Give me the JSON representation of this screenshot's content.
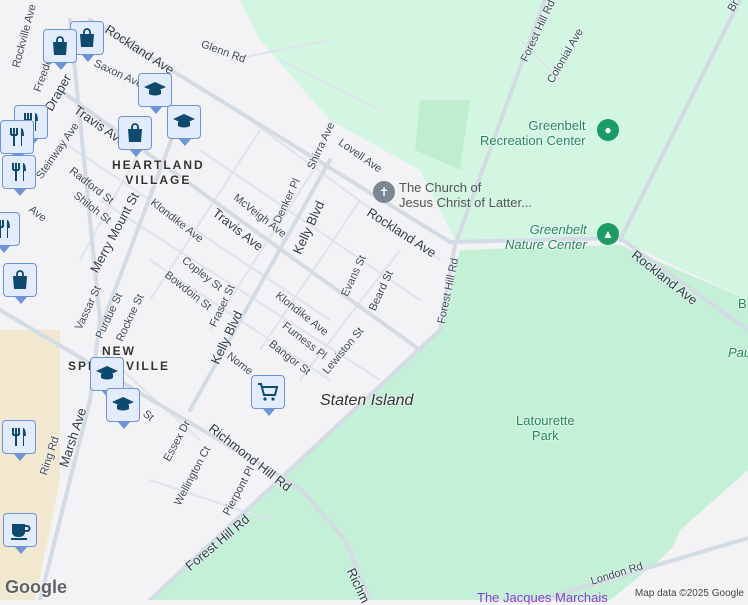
{
  "streets": {
    "rockland_top": "Rockland Ave",
    "rockland_mid": "Rockland Ave",
    "rockland_east": "Rockland Ave",
    "glenn": "Glenn Rd",
    "saxon": "Saxon Ave",
    "rockville": "Rockville Ave",
    "freedom": "Freedom Ave",
    "draper": "Draper",
    "travis_w": "Travis Ave",
    "travis_e": "Travis Ave",
    "steinway": "Steinway Ave",
    "radford": "Radford St",
    "shiloh": "Shiloh St",
    "ave_left": "Ave",
    "merry_mount": "Merry Mount St",
    "klondike_w": "Klondike Ave",
    "klondike_e": "Klondike Ave",
    "mcveigh": "McVeigh Ave",
    "denker": "Denker Pl",
    "kelly_n": "Kelly Blvd",
    "kelly_s": "Kelly Blvd",
    "shirra": "Shirra Ave",
    "lovell": "Lovell Ave",
    "evans": "Evans St",
    "beard": "Beard St",
    "forest_hill_n": "Forest Hill Rd",
    "forest_hill_mid": "Forest Hill Rd",
    "forest_hill_s": "Forest Hill Rd",
    "colonial": "Colonial Ave",
    "copley": "Copley St",
    "bowdoin": "Bowdoin St",
    "fraser": "Fraser St",
    "vassar": "Vassar St",
    "purdue": "Purdue St",
    "rockne": "Rockne St",
    "furness": "Furness Pl",
    "bangor": "Bangor St",
    "lewiston": "Lewiston St",
    "nome": "Nome",
    "richmond_hill": "Richmond Hill Rd",
    "richmond_s": "Richm",
    "essex": "Essex Dr",
    "wellington": "Wellington Ct",
    "pierpont": "Pierpont Pl",
    "marsh": "Marsh Ave",
    "ring": "Ring Rd",
    "london": "London Rd",
    "br": "Br",
    "st_frag": "St"
  },
  "neighborhoods": {
    "heartland": "HEARTLAND\nVILLAGE",
    "new_springville": "NEW\nSPRINGVILLE"
  },
  "city": "Staten Island",
  "places": {
    "church": "The Church of\nJesus Christ of Latter...",
    "rec_center": "Greenbelt\nRecreation Center",
    "nature_center": "Greenbelt\nNature Center",
    "latourette": "Latourette\nPark",
    "pau": "Pau",
    "b_frag": "B",
    "jacques": "The Jacques Marchais"
  },
  "markers": [
    "shopping",
    "shopping",
    "school",
    "school",
    "shopping",
    "restaurant",
    "restaurant",
    "restaurant",
    "restaurant",
    "shopping",
    "school",
    "school",
    "grocery",
    "restaurant",
    "cafe"
  ],
  "attribution": "Map data ©2025 Google",
  "logo": "Google",
  "colors": {
    "land": "#f3f2f4",
    "park": "#c3f0d6",
    "green_light": "#d3f6e3",
    "road": "#d6dde6",
    "marker_fill": "#e3ecfc",
    "marker_border": "#6d94d8",
    "icon": "#0d4a6e",
    "park_text": "#1e8a5a"
  }
}
